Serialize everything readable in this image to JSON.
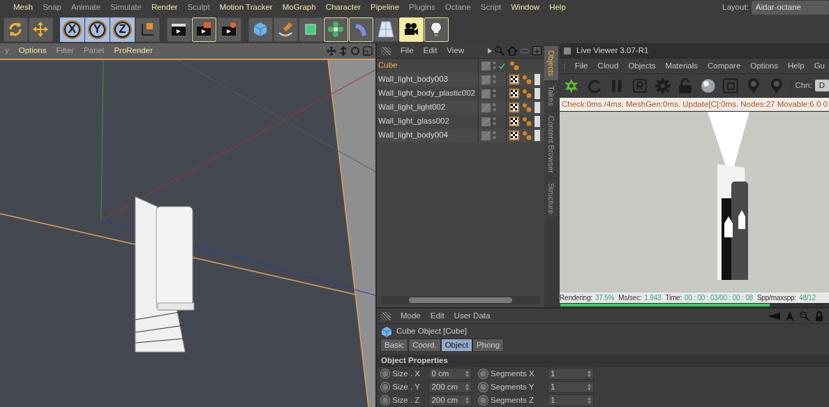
{
  "menu_bar": {
    "items": [
      {
        "label": "Mesh",
        "highlighted": true
      },
      {
        "label": "Snap",
        "highlighted": false
      },
      {
        "label": "Animate",
        "highlighted": false
      },
      {
        "label": "Simulate",
        "highlighted": false
      },
      {
        "label": "Render",
        "highlighted": true
      },
      {
        "label": "Sculpt",
        "highlighted": false
      },
      {
        "label": "Motion Tracker",
        "highlighted": true
      },
      {
        "label": "MoGraph",
        "highlighted": true
      },
      {
        "label": "Character",
        "highlighted": true
      },
      {
        "label": "Pipeline",
        "highlighted": true
      },
      {
        "label": "Plugins",
        "highlighted": false
      },
      {
        "label": "Octane",
        "highlighted": false
      },
      {
        "label": "Script",
        "highlighted": false
      },
      {
        "label": "Window",
        "highlighted": true
      },
      {
        "label": "Help",
        "highlighted": true
      }
    ],
    "layout_label": "Layout:",
    "layout_value": "Aidar-octane"
  },
  "toolbar": {
    "groups": [
      [
        {
          "kind": "tool",
          "active": false
        },
        {
          "kind": "tool",
          "active": false
        }
      ],
      [
        {
          "kind": "axis",
          "label": "X",
          "active": true
        },
        {
          "kind": "axis",
          "label": "Y",
          "active": true
        },
        {
          "kind": "axis",
          "label": "Z",
          "active": true
        },
        {
          "kind": "tool",
          "active": false
        }
      ],
      [
        {
          "kind": "tool",
          "active": false
        },
        {
          "kind": "tool",
          "active": true
        },
        {
          "kind": "tool",
          "active": false
        }
      ],
      [
        {
          "kind": "tool",
          "active": false
        },
        {
          "kind": "tool",
          "active": false
        },
        {
          "kind": "tool",
          "active": false
        },
        {
          "kind": "tool",
          "active": true
        },
        {
          "kind": "tool",
          "active": true
        },
        {
          "kind": "tool",
          "active": false
        },
        {
          "kind": "tool",
          "active": true
        },
        {
          "kind": "tool",
          "active": true
        }
      ]
    ]
  },
  "viewport": {
    "menu": [
      {
        "label": "y",
        "highlighted": false
      },
      {
        "label": "Options",
        "highlighted": true
      },
      {
        "label": "Filter",
        "highlighted": false
      },
      {
        "label": "Panel",
        "highlighted": false
      },
      {
        "label": "ProRender",
        "highlighted": true
      }
    ]
  },
  "object_manager": {
    "menu": [
      "File",
      "Edit",
      "View"
    ],
    "objects": [
      {
        "name": "Cube",
        "active": true,
        "checked": true,
        "material": false
      },
      {
        "name": "Wall_light_body003",
        "active": false,
        "checked": false,
        "material": true
      },
      {
        "name": "Wall_light_body_plastic002",
        "active": false,
        "checked": false,
        "material": true
      },
      {
        "name": "Wall_light_light002",
        "active": false,
        "checked": false,
        "material": true
      },
      {
        "name": "Wall_light_glass002",
        "active": false,
        "checked": false,
        "material": true
      },
      {
        "name": "Wall_light_body004",
        "active": false,
        "checked": false,
        "material": true
      }
    ]
  },
  "side_tabs": [
    {
      "label": "Objects",
      "selected": true
    },
    {
      "label": "Takes",
      "selected": false
    },
    {
      "label": "Content Browser",
      "selected": false
    },
    {
      "label": "Structure",
      "selected": false
    }
  ],
  "live_viewer": {
    "title": "Live Viewer 3.07-R1",
    "menu": [
      "File",
      "Cloud",
      "Objects",
      "Materials",
      "Compare",
      "Options",
      "Help",
      "Gu"
    ],
    "channel_label": "Chn:",
    "channel_value": "D",
    "status": "Check:0ms./4ms. MeshGen:0ms. Update[C]:0ms. Nodes:27 Movable:6 0 0",
    "stats": [
      {
        "label": "Rendering:",
        "value": "37.5%"
      },
      {
        "label": "Ms/sec:",
        "value": "1.943"
      },
      {
        "label": "Time:",
        "value": "00 : 00 : 03/00 : 00 : 08"
      },
      {
        "label": "Spp/maxspp:",
        "value": "48/12"
      }
    ],
    "progress": {
      "level": 0.78
    }
  },
  "attributes": {
    "menu": [
      "Mode",
      "Edit",
      "User Data"
    ],
    "title": "Cube Object [Cube]",
    "tabs": [
      {
        "label": "Basic",
        "selected": false
      },
      {
        "label": "Coord.",
        "selected": false
      },
      {
        "label": "Object",
        "selected": true
      },
      {
        "label": "Phong",
        "selected": false
      }
    ],
    "section": "Object Properties",
    "fields": [
      [
        {
          "label": "Size . X",
          "value": "0 cm"
        },
        {
          "label": "Segments X",
          "value": "1"
        }
      ],
      [
        {
          "label": "Size . Y",
          "value": "200 cm"
        },
        {
          "label": "Segments Y",
          "value": "1"
        }
      ],
      [
        {
          "label": "Size . Z",
          "value": "200 cm"
        },
        {
          "label": "Segments Z",
          "value": "1"
        }
      ]
    ]
  }
}
